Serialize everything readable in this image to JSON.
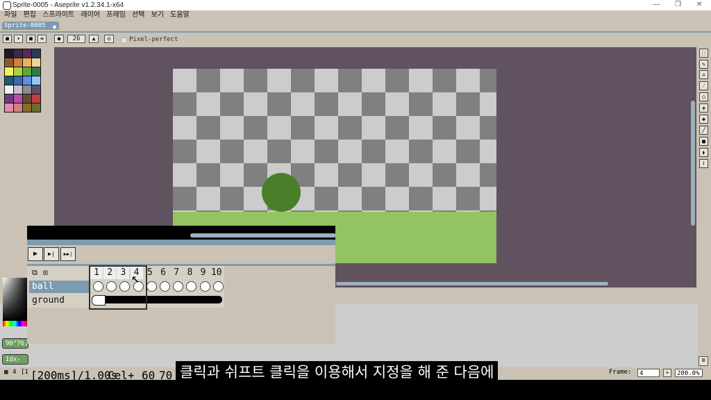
{
  "window": {
    "title": "Sprite-0005 - Aseprite v1.2.34.1-x64",
    "min": "—",
    "max": "❐",
    "close": "✕"
  },
  "menu": [
    "파일",
    "편집",
    "스프라이트",
    "레이어",
    "프레임",
    "선택",
    "보기",
    "도움말"
  ],
  "tab": {
    "label": "Sprite-0005",
    "modified": "●"
  },
  "toolbar": {
    "brush_size": "26",
    "pixel_perfect": "Pixel-perfect"
  },
  "palette": [
    "#1a1c2c",
    "#3b2b4a",
    "#5d275d",
    "#2a3b5c",
    "#8b5a2b",
    "#d77a3c",
    "#e8b25e",
    "#f2d49a",
    "#f4f066",
    "#a7d640",
    "#5fa83a",
    "#2e7a4a",
    "#255a6b",
    "#3b6aa8",
    "#5c8ee3",
    "#94c6f2",
    "#f2f2f2",
    "#c2c3c7",
    "#8a8b93",
    "#555566",
    "#6d3b7a",
    "#b84ea8",
    "#6a4a2a",
    "#c44040",
    "#e38ab0",
    "#d08080",
    "#8a6a2a",
    "#6e6e2a"
  ],
  "playback": {
    "play": "▶",
    "next": "▶|",
    "last": "▶▶|"
  },
  "layers": {
    "ball": "ball",
    "ground": "ground"
  },
  "frames": [
    "1",
    "2",
    "3",
    "4",
    "5",
    "6",
    "7",
    "8",
    "9",
    "10"
  ],
  "color_readouts": {
    "value1": "90°76,",
    "value2": "Idx-"
  },
  "status": {
    "left_number": "4",
    "left_bracket": "[1",
    "duration": "[200ms]/1.00s",
    "cel": "Cel",
    "plus": "+",
    "coord_x": "60",
    "coord_y": "70",
    "frame_label": "Frame:",
    "frame_value": "4",
    "zoom": "200.0%"
  },
  "subtitle": "클릭과 쉬프트 클릭을 이용해서 지정을 해 준 다음에"
}
